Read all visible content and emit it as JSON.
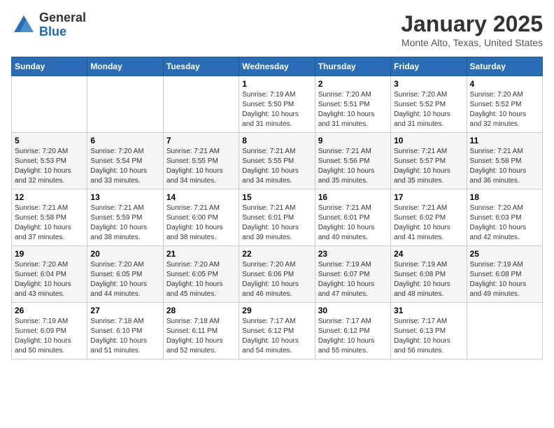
{
  "logo": {
    "general": "General",
    "blue": "Blue"
  },
  "header": {
    "title": "January 2025",
    "subtitle": "Monte Alto, Texas, United States"
  },
  "weekdays": [
    "Sunday",
    "Monday",
    "Tuesday",
    "Wednesday",
    "Thursday",
    "Friday",
    "Saturday"
  ],
  "weeks": [
    [
      {
        "day": "",
        "sunrise": "",
        "sunset": "",
        "daylight": ""
      },
      {
        "day": "",
        "sunrise": "",
        "sunset": "",
        "daylight": ""
      },
      {
        "day": "",
        "sunrise": "",
        "sunset": "",
        "daylight": ""
      },
      {
        "day": "1",
        "sunrise": "Sunrise: 7:19 AM",
        "sunset": "Sunset: 5:50 PM",
        "daylight": "Daylight: 10 hours and 31 minutes."
      },
      {
        "day": "2",
        "sunrise": "Sunrise: 7:20 AM",
        "sunset": "Sunset: 5:51 PM",
        "daylight": "Daylight: 10 hours and 31 minutes."
      },
      {
        "day": "3",
        "sunrise": "Sunrise: 7:20 AM",
        "sunset": "Sunset: 5:52 PM",
        "daylight": "Daylight: 10 hours and 31 minutes."
      },
      {
        "day": "4",
        "sunrise": "Sunrise: 7:20 AM",
        "sunset": "Sunset: 5:52 PM",
        "daylight": "Daylight: 10 hours and 32 minutes."
      }
    ],
    [
      {
        "day": "5",
        "sunrise": "Sunrise: 7:20 AM",
        "sunset": "Sunset: 5:53 PM",
        "daylight": "Daylight: 10 hours and 32 minutes."
      },
      {
        "day": "6",
        "sunrise": "Sunrise: 7:20 AM",
        "sunset": "Sunset: 5:54 PM",
        "daylight": "Daylight: 10 hours and 33 minutes."
      },
      {
        "day": "7",
        "sunrise": "Sunrise: 7:21 AM",
        "sunset": "Sunset: 5:55 PM",
        "daylight": "Daylight: 10 hours and 34 minutes."
      },
      {
        "day": "8",
        "sunrise": "Sunrise: 7:21 AM",
        "sunset": "Sunset: 5:55 PM",
        "daylight": "Daylight: 10 hours and 34 minutes."
      },
      {
        "day": "9",
        "sunrise": "Sunrise: 7:21 AM",
        "sunset": "Sunset: 5:56 PM",
        "daylight": "Daylight: 10 hours and 35 minutes."
      },
      {
        "day": "10",
        "sunrise": "Sunrise: 7:21 AM",
        "sunset": "Sunset: 5:57 PM",
        "daylight": "Daylight: 10 hours and 35 minutes."
      },
      {
        "day": "11",
        "sunrise": "Sunrise: 7:21 AM",
        "sunset": "Sunset: 5:58 PM",
        "daylight": "Daylight: 10 hours and 36 minutes."
      }
    ],
    [
      {
        "day": "12",
        "sunrise": "Sunrise: 7:21 AM",
        "sunset": "Sunset: 5:58 PM",
        "daylight": "Daylight: 10 hours and 37 minutes."
      },
      {
        "day": "13",
        "sunrise": "Sunrise: 7:21 AM",
        "sunset": "Sunset: 5:59 PM",
        "daylight": "Daylight: 10 hours and 38 minutes."
      },
      {
        "day": "14",
        "sunrise": "Sunrise: 7:21 AM",
        "sunset": "Sunset: 6:00 PM",
        "daylight": "Daylight: 10 hours and 38 minutes."
      },
      {
        "day": "15",
        "sunrise": "Sunrise: 7:21 AM",
        "sunset": "Sunset: 6:01 PM",
        "daylight": "Daylight: 10 hours and 39 minutes."
      },
      {
        "day": "16",
        "sunrise": "Sunrise: 7:21 AM",
        "sunset": "Sunset: 6:01 PM",
        "daylight": "Daylight: 10 hours and 40 minutes."
      },
      {
        "day": "17",
        "sunrise": "Sunrise: 7:21 AM",
        "sunset": "Sunset: 6:02 PM",
        "daylight": "Daylight: 10 hours and 41 minutes."
      },
      {
        "day": "18",
        "sunrise": "Sunrise: 7:20 AM",
        "sunset": "Sunset: 6:03 PM",
        "daylight": "Daylight: 10 hours and 42 minutes."
      }
    ],
    [
      {
        "day": "19",
        "sunrise": "Sunrise: 7:20 AM",
        "sunset": "Sunset: 6:04 PM",
        "daylight": "Daylight: 10 hours and 43 minutes."
      },
      {
        "day": "20",
        "sunrise": "Sunrise: 7:20 AM",
        "sunset": "Sunset: 6:05 PM",
        "daylight": "Daylight: 10 hours and 44 minutes."
      },
      {
        "day": "21",
        "sunrise": "Sunrise: 7:20 AM",
        "sunset": "Sunset: 6:05 PM",
        "daylight": "Daylight: 10 hours and 45 minutes."
      },
      {
        "day": "22",
        "sunrise": "Sunrise: 7:20 AM",
        "sunset": "Sunset: 6:06 PM",
        "daylight": "Daylight: 10 hours and 46 minutes."
      },
      {
        "day": "23",
        "sunrise": "Sunrise: 7:19 AM",
        "sunset": "Sunset: 6:07 PM",
        "daylight": "Daylight: 10 hours and 47 minutes."
      },
      {
        "day": "24",
        "sunrise": "Sunrise: 7:19 AM",
        "sunset": "Sunset: 6:08 PM",
        "daylight": "Daylight: 10 hours and 48 minutes."
      },
      {
        "day": "25",
        "sunrise": "Sunrise: 7:19 AM",
        "sunset": "Sunset: 6:08 PM",
        "daylight": "Daylight: 10 hours and 49 minutes."
      }
    ],
    [
      {
        "day": "26",
        "sunrise": "Sunrise: 7:19 AM",
        "sunset": "Sunset: 6:09 PM",
        "daylight": "Daylight: 10 hours and 50 minutes."
      },
      {
        "day": "27",
        "sunrise": "Sunrise: 7:18 AM",
        "sunset": "Sunset: 6:10 PM",
        "daylight": "Daylight: 10 hours and 51 minutes."
      },
      {
        "day": "28",
        "sunrise": "Sunrise: 7:18 AM",
        "sunset": "Sunset: 6:11 PM",
        "daylight": "Daylight: 10 hours and 52 minutes."
      },
      {
        "day": "29",
        "sunrise": "Sunrise: 7:17 AM",
        "sunset": "Sunset: 6:12 PM",
        "daylight": "Daylight: 10 hours and 54 minutes."
      },
      {
        "day": "30",
        "sunrise": "Sunrise: 7:17 AM",
        "sunset": "Sunset: 6:12 PM",
        "daylight": "Daylight: 10 hours and 55 minutes."
      },
      {
        "day": "31",
        "sunrise": "Sunrise: 7:17 AM",
        "sunset": "Sunset: 6:13 PM",
        "daylight": "Daylight: 10 hours and 56 minutes."
      },
      {
        "day": "",
        "sunrise": "",
        "sunset": "",
        "daylight": ""
      }
    ]
  ]
}
